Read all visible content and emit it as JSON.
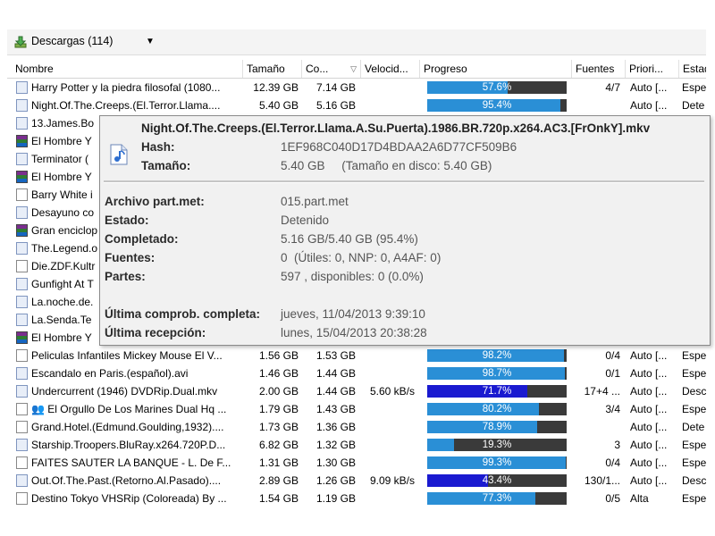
{
  "toolbar": {
    "title": "Descargas (114)",
    "dropdown_icon": "caret-down-icon"
  },
  "columns": [
    "Nombre",
    "Tamaño",
    "Co...",
    "Velocid...",
    "Progreso",
    "Fuentes",
    "Priori...",
    "Estad"
  ],
  "rows": [
    {
      "name": "Harry Potter y la piedra filosofal (1080...",
      "icon": "file",
      "size": "12.39 GB",
      "completed": "7.14 GB",
      "speed": "",
      "progress": "57.6%",
      "progress_value": 57.6,
      "color": "#2a8fd6",
      "sources": "4/7",
      "priority": "Auto [...",
      "state": "Espe"
    },
    {
      "name": "Night.Of.The.Creeps.(El.Terror.Llama....",
      "icon": "file",
      "size": "5.40 GB",
      "completed": "5.16 GB",
      "speed": "",
      "progress": "95.4%",
      "progress_value": 95.4,
      "color": "#2a8fd6",
      "sources": "",
      "priority": "Auto [...",
      "state": "Dete"
    },
    {
      "name": "13.James.Bo",
      "icon": "file",
      "size": "",
      "completed": "",
      "speed": "",
      "progress": "",
      "progress_value": 0,
      "color": "#2a8fd6",
      "sources": "",
      "priority": "",
      "state": ""
    },
    {
      "name": "El Hombre Y",
      "icon": "rar",
      "size": "",
      "completed": "",
      "speed": "",
      "progress": "",
      "progress_value": 0,
      "color": "#2a8fd6",
      "sources": "",
      "priority": "",
      "state": ""
    },
    {
      "name": "Terminator (",
      "icon": "file",
      "size": "",
      "completed": "",
      "speed": "",
      "progress": "",
      "progress_value": 0,
      "color": "#2a8fd6",
      "sources": "",
      "priority": "",
      "state": ""
    },
    {
      "name": "El Hombre Y",
      "icon": "rar",
      "size": "",
      "completed": "",
      "speed": "",
      "progress": "",
      "progress_value": 0,
      "color": "#2a8fd6",
      "sources": "",
      "priority": "",
      "state": ""
    },
    {
      "name": "Barry White i",
      "icon": "movie",
      "size": "",
      "completed": "",
      "speed": "",
      "progress": "",
      "progress_value": 0,
      "color": "#2a8fd6",
      "sources": "",
      "priority": "",
      "state": ""
    },
    {
      "name": "Desayuno co",
      "icon": "file",
      "size": "",
      "completed": "",
      "speed": "",
      "progress": "",
      "progress_value": 0,
      "color": "#2a8fd6",
      "sources": "",
      "priority": "",
      "state": ""
    },
    {
      "name": "Gran enciclop",
      "icon": "rar",
      "size": "",
      "completed": "",
      "speed": "",
      "progress": "",
      "progress_value": 0,
      "color": "#2a8fd6",
      "sources": "",
      "priority": "",
      "state": ""
    },
    {
      "name": "The.Legend.o",
      "icon": "file",
      "size": "",
      "completed": "",
      "speed": "",
      "progress": "",
      "progress_value": 0,
      "color": "#2a8fd6",
      "sources": "",
      "priority": "",
      "state": ""
    },
    {
      "name": "Die.ZDF.Kultr",
      "icon": "movie",
      "size": "",
      "completed": "",
      "speed": "",
      "progress": "",
      "progress_value": 0,
      "color": "#2a8fd6",
      "sources": "",
      "priority": "",
      "state": ""
    },
    {
      "name": "Gunfight At T",
      "icon": "file",
      "size": "",
      "completed": "",
      "speed": "",
      "progress": "",
      "progress_value": 0,
      "color": "#2a8fd6",
      "sources": "",
      "priority": "",
      "state": ""
    },
    {
      "name": "La.noche.de.",
      "icon": "file",
      "size": "",
      "completed": "",
      "speed": "",
      "progress": "",
      "progress_value": 0,
      "color": "#2a8fd6",
      "sources": "",
      "priority": "",
      "state": ""
    },
    {
      "name": "La.Senda.Te",
      "icon": "file",
      "size": "",
      "completed": "",
      "speed": "",
      "progress": "",
      "progress_value": 0,
      "color": "#2a8fd6",
      "sources": "",
      "priority": "",
      "state": ""
    },
    {
      "name": "El Hombre Y",
      "icon": "rar",
      "size": "",
      "completed": "",
      "speed": "",
      "progress": "",
      "progress_value": 0,
      "color": "#2a8fd6",
      "sources": "",
      "priority": "",
      "state": ""
    },
    {
      "name": "Peliculas Infantiles Mickey Mouse El V...",
      "icon": "movie",
      "size": "1.56 GB",
      "completed": "1.53 GB",
      "speed": "",
      "progress": "98.2%",
      "progress_value": 98.2,
      "color": "#2a8fd6",
      "sources": "0/4",
      "priority": "Auto [...",
      "state": "Espe"
    },
    {
      "name": "Escandalo en Paris.(español).avi",
      "icon": "file",
      "size": "1.46 GB",
      "completed": "1.44 GB",
      "speed": "",
      "progress": "98.7%",
      "progress_value": 98.7,
      "color": "#2a8fd6",
      "sources": "0/1",
      "priority": "Auto [...",
      "state": "Espe"
    },
    {
      "name": "Undercurrent (1946) DVDRip.Dual.mkv",
      "icon": "file",
      "size": "2.00 GB",
      "completed": "1.44 GB",
      "speed": "5.60 kB/s",
      "progress": "71.7%",
      "progress_value": 71.7,
      "color": "#1a1ad0",
      "sources": "17+4 ...",
      "priority": "Auto [...",
      "state": "Desc"
    },
    {
      "name": "👥 El Orgullo De Los Marines Dual Hq ...",
      "icon": "movie",
      "size": "1.79 GB",
      "completed": "1.43 GB",
      "speed": "",
      "progress": "80.2%",
      "progress_value": 80.2,
      "color": "#2a8fd6",
      "sources": "3/4",
      "priority": "Auto [...",
      "state": "Espe"
    },
    {
      "name": "Grand.Hotel.(Edmund.Goulding,1932)....",
      "icon": "movie",
      "size": "1.73 GB",
      "completed": "1.36 GB",
      "speed": "",
      "progress": "78.9%",
      "progress_value": 78.9,
      "color": "#2a8fd6",
      "sources": "",
      "priority": "Auto [...",
      "state": "Dete"
    },
    {
      "name": "Starship.Troopers.BluRay.x264.720P.D...",
      "icon": "file",
      "size": "6.82 GB",
      "completed": "1.32 GB",
      "speed": "",
      "progress": "19.3%",
      "progress_value": 19.3,
      "color": "#2a8fd6",
      "sources": "3",
      "priority": "Auto [...",
      "state": "Espe"
    },
    {
      "name": "FAITES SAUTER LA BANQUE - L. De F...",
      "icon": "movie",
      "size": "1.31 GB",
      "completed": "1.30 GB",
      "speed": "",
      "progress": "99.3%",
      "progress_value": 99.3,
      "color": "#2a8fd6",
      "sources": "0/4",
      "priority": "Auto [...",
      "state": "Espe"
    },
    {
      "name": "Out.Of.The.Past.(Retorno.Al.Pasado)....",
      "icon": "file",
      "size": "2.89 GB",
      "completed": "1.26 GB",
      "speed": "9.09 kB/s",
      "progress": "43.4%",
      "progress_value": 43.4,
      "color": "#1a1ad0",
      "sources": "130/1...",
      "priority": "Auto [...",
      "state": "Desc"
    },
    {
      "name": "Destino Tokyo VHSRip (Coloreada) By ...",
      "icon": "movie",
      "size": "1.54 GB",
      "completed": "1.19 GB",
      "speed": "",
      "progress": "77.3%",
      "progress_value": 77.3,
      "color": "#2a8fd6",
      "sources": "0/5",
      "priority": "Alta",
      "state": "Espe"
    }
  ],
  "tooltip": {
    "title": "Night.Of.The.Creeps.(El.Terror.Llama.A.Su.Puerta).1986.BR.720p.x264.AC3.[FrOnkY].mkv",
    "hash_label": "Hash:",
    "hash": "1EF968C040D17D4BDAA2A6D77CF509B6",
    "size_label": "Tamaño:",
    "size": "5.40 GB     (Tamaño en disco: 5.40 GB)",
    "partmet_label": "Archivo part.met:",
    "partmet": "015.part.met",
    "state_label": "Estado:",
    "state": "Detenido",
    "completed_label": "Completado:",
    "completed": "5.16 GB/5.40 GB (95.4%)",
    "sources_label": "Fuentes:",
    "sources": "0  (Útiles: 0, NNP: 0, A4AF: 0)",
    "parts_label": "Partes:",
    "parts": "597 , disponibles: 0 (0.0%)",
    "lastcheck_label": "Última comprob. completa:",
    "lastcheck": "jueves, 11/04/2013 9:39:10",
    "lastrecv_label": "Última recepción:",
    "lastrecv": "lunes, 15/04/2013 20:38:28"
  }
}
